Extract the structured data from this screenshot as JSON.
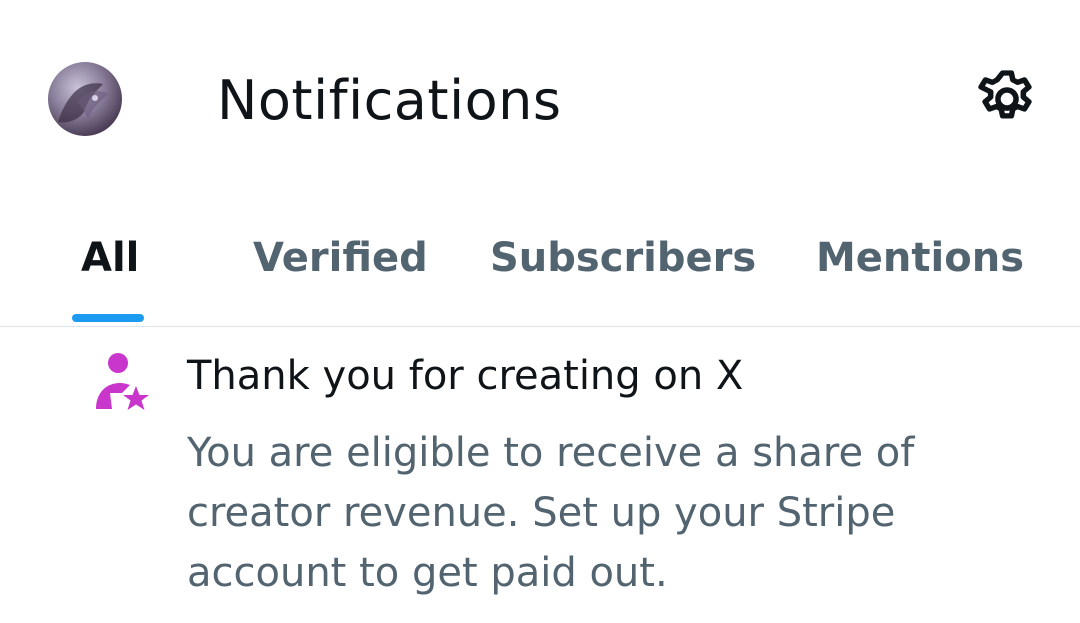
{
  "header": {
    "title": "Notifications",
    "avatar_icon": "user-avatar",
    "settings_icon": "gear-icon"
  },
  "tabs": [
    {
      "label": "All",
      "active": true
    },
    {
      "label": "Verified",
      "active": false
    },
    {
      "label": "Subscribers",
      "active": false
    },
    {
      "label": "Mentions",
      "active": false
    }
  ],
  "notification": {
    "icon": "creator-star-icon",
    "icon_color": "#c936cc",
    "title": "Thank you for creating on X",
    "body": "You are eligible to receive a share of creator revenue. Set up your Stripe account to get paid out."
  },
  "colors": {
    "accent": "#1d9bf0",
    "primary_text": "#0f1419",
    "secondary_text": "#536471"
  }
}
